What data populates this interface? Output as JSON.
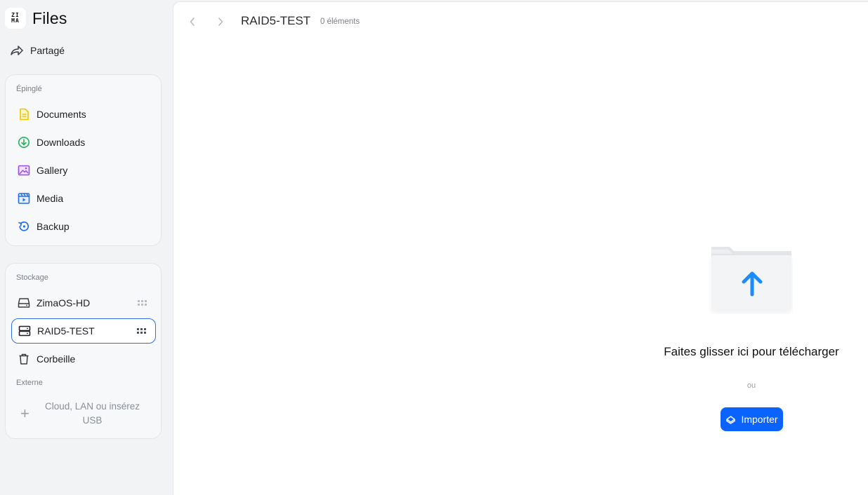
{
  "app": {
    "logo_top": "ZI",
    "logo_bottom": "MA",
    "title": "Files"
  },
  "sidebar": {
    "shared_label": "Partagé",
    "pinned": {
      "section_label": "Épinglé",
      "items": [
        {
          "label": "Documents",
          "icon": "document-icon",
          "color": "#f2c200"
        },
        {
          "label": "Downloads",
          "icon": "download-icon",
          "color": "#22b35c"
        },
        {
          "label": "Gallery",
          "icon": "gallery-icon",
          "color": "#9b4dea"
        },
        {
          "label": "Media",
          "icon": "media-icon",
          "color": "#1f6ff0"
        },
        {
          "label": "Backup",
          "icon": "backup-icon",
          "color": "#1f6ff0"
        }
      ]
    },
    "storage": {
      "section_label": "Stockage",
      "items": [
        {
          "label": "ZimaOS-HD",
          "icon": "drive-icon",
          "active": false
        },
        {
          "label": "RAID5-TEST",
          "icon": "raid-icon",
          "active": true
        },
        {
          "label": "Corbeille",
          "icon": "trash-icon",
          "active": false
        }
      ],
      "external_label": "Externe",
      "add_external_text": "Cloud, LAN ou insérez USB"
    }
  },
  "main": {
    "breadcrumb_title": "RAID5-TEST",
    "item_count": "0 éléments",
    "drop_text": "Faites glisser ici pour télécharger",
    "or_text": "ou",
    "import_label": "Importer",
    "accent_color": "#0a63ff"
  }
}
